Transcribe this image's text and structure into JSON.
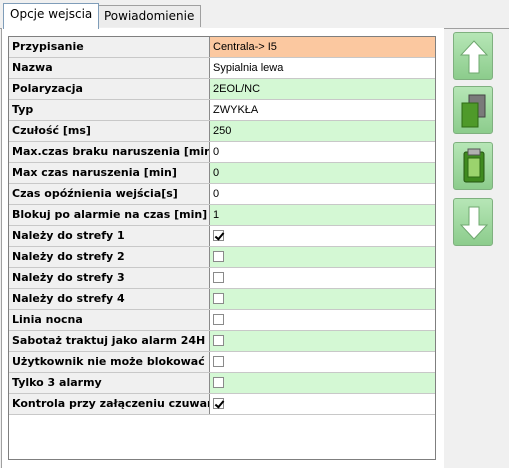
{
  "tabs": [
    {
      "label": "Opcje wejscia"
    },
    {
      "label": "Powiadomienie"
    }
  ],
  "colors": {
    "assignment_highlight": "#fbc8a0",
    "row_green": "#d4f8d4",
    "row_white": "#ffffff",
    "label_bg": "#f0f0f0"
  },
  "properties": [
    {
      "label": "Przypisanie",
      "value": "Centrala-> I5",
      "kind": "text"
    },
    {
      "label": "Nazwa",
      "value": "Sypialnia lewa",
      "kind": "text"
    },
    {
      "label": "Polaryzacja",
      "value": "2EOL/NC",
      "kind": "text"
    },
    {
      "label": "Typ",
      "value": "ZWYKŁA",
      "kind": "text"
    },
    {
      "label": "Czułość [ms]",
      "value": "250",
      "kind": "text"
    },
    {
      "label": "Max.czas braku naruszenia [min]",
      "value": "0",
      "kind": "text"
    },
    {
      "label": "Max czas naruszenia [min]",
      "value": "0",
      "kind": "text"
    },
    {
      "label": "Czas opóźnienia wejścia[s]",
      "value": "0",
      "kind": "text"
    },
    {
      "label": "Blokuj po alarmie na czas [min]",
      "value": "1",
      "kind": "text"
    },
    {
      "label": "Należy do strefy 1",
      "checked": true,
      "kind": "checkbox"
    },
    {
      "label": "Należy do strefy 2",
      "checked": false,
      "kind": "checkbox"
    },
    {
      "label": "Należy do strefy 3",
      "checked": false,
      "kind": "checkbox"
    },
    {
      "label": "Należy do strefy 4",
      "checked": false,
      "kind": "checkbox"
    },
    {
      "label": "Linia nocna",
      "checked": false,
      "kind": "checkbox"
    },
    {
      "label": "Sabotaż traktuj jako alarm  24H",
      "checked": false,
      "kind": "checkbox"
    },
    {
      "label": "Użytkownik nie może blokować",
      "checked": false,
      "kind": "checkbox"
    },
    {
      "label": "Tylko 3 alarmy",
      "checked": false,
      "kind": "checkbox"
    },
    {
      "label": "Kontrola przy załączeniu czuwania",
      "checked": true,
      "kind": "checkbox"
    }
  ],
  "sidebar": [
    {
      "icon": "arrow-up-icon"
    },
    {
      "icon": "copy-icon"
    },
    {
      "icon": "paste-icon"
    },
    {
      "icon": "arrow-down-icon"
    }
  ]
}
